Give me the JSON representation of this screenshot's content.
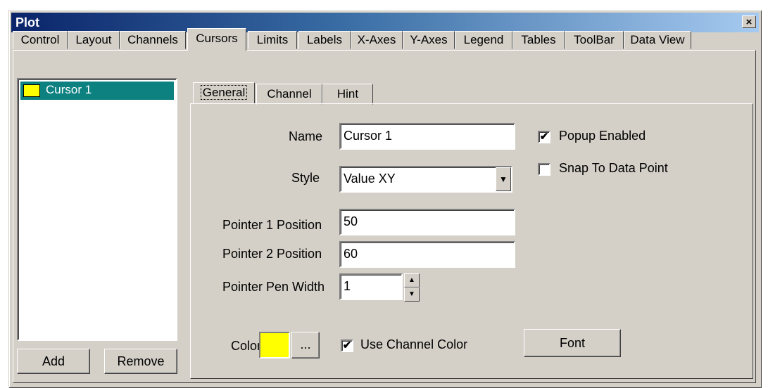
{
  "window": {
    "title": "Plot",
    "close_glyph": "×"
  },
  "tabs": [
    {
      "label": "Control"
    },
    {
      "label": "Layout"
    },
    {
      "label": "Channels"
    },
    {
      "label": "Cursors"
    },
    {
      "label": "Limits"
    },
    {
      "label": "Labels"
    },
    {
      "label": "X-Axes"
    },
    {
      "label": "Y-Axes"
    },
    {
      "label": "Legend"
    },
    {
      "label": "Tables"
    },
    {
      "label": "ToolBar"
    },
    {
      "label": "Data View"
    }
  ],
  "active_tab": "Cursors",
  "cursor_list": {
    "items": [
      {
        "label": "Cursor 1",
        "color": "#ffff00",
        "selected": true
      }
    ],
    "add_label": "Add",
    "remove_label": "Remove"
  },
  "inner_tabs": [
    {
      "label": "General"
    },
    {
      "label": "Channel"
    },
    {
      "label": "Hint"
    }
  ],
  "general": {
    "name_label": "Name",
    "name_value": "Cursor 1",
    "style_label": "Style",
    "style_value": "Value XY",
    "pointer1_label": "Pointer 1 Position",
    "pointer1_value": "50",
    "pointer2_label": "Pointer 2 Position",
    "pointer2_value": "60",
    "pen_width_label": "Pointer Pen Width",
    "pen_width_value": "1",
    "color_label": "Color",
    "color_value": "#ffff00",
    "color_button_label": "...",
    "use_channel_color_label": "Use Channel Color",
    "use_channel_color_checked": true,
    "popup_enabled_label": "Popup Enabled",
    "popup_enabled_checked": true,
    "snap_label": "Snap To Data Point",
    "snap_checked": false,
    "font_button_label": "Font"
  },
  "icons": {
    "check": "✔",
    "dropdown": "▼",
    "spin_up": "▲",
    "spin_down": "▼"
  }
}
